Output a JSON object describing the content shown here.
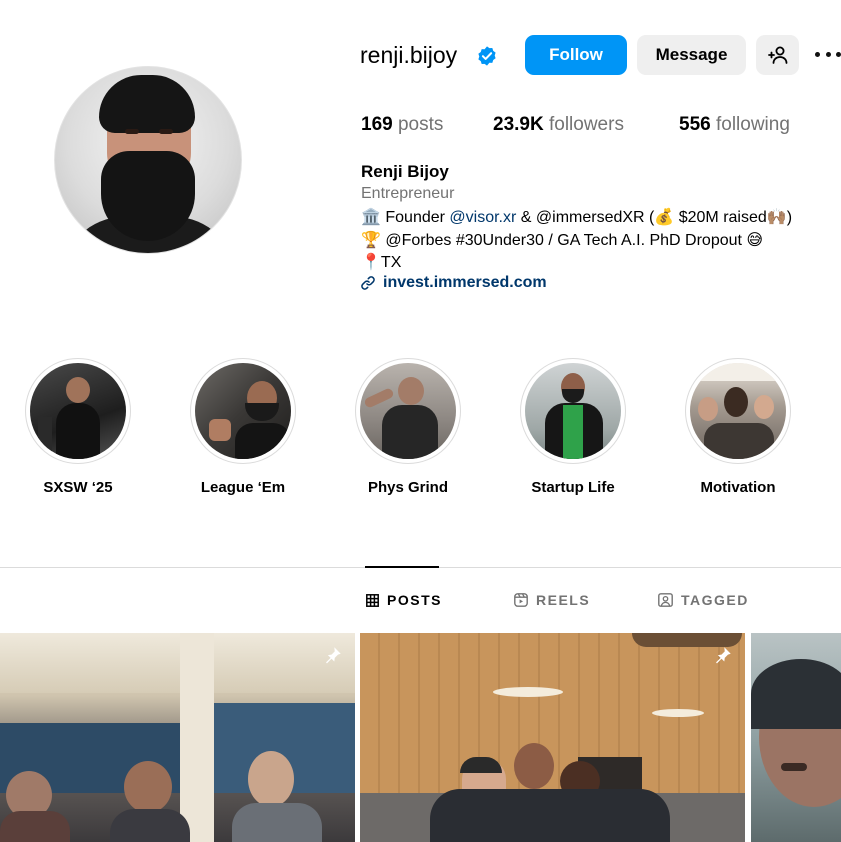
{
  "profile": {
    "username": "renji.bijoy",
    "verified_icon": "verified-badge-icon",
    "full_name": "Renji Bijoy",
    "category": "Entrepreneur",
    "stats": {
      "posts_count": "169",
      "posts_label": "posts",
      "followers_count": "23.9K",
      "followers_label": "followers",
      "following_count": "556",
      "following_label": "following"
    },
    "bio": {
      "line1_prefix": "🏛️ Founder ",
      "line1_link": "@visor.xr",
      "line1_suffix": " & @immersedXR (💰 $20M raised🙌🏽)",
      "line2": "🏆 @Forbes #30Under30 / GA Tech A.I. PhD Dropout 😅",
      "line3": "📍TX"
    },
    "link": "invest.immersed.com"
  },
  "actions": {
    "follow_label": "Follow",
    "message_label": "Message",
    "add_user_icon": "add-user-icon",
    "more_icon": "more-options-icon"
  },
  "highlights": [
    {
      "label": "SXSW ‘25"
    },
    {
      "label": "League ‘Em"
    },
    {
      "label": "Phys Grind"
    },
    {
      "label": "Startup Life"
    },
    {
      "label": "Motivation"
    }
  ],
  "tabs": [
    {
      "label": "POSTS",
      "icon": "grid-icon",
      "active": true
    },
    {
      "label": "REELS",
      "icon": "reels-icon",
      "active": false
    },
    {
      "label": "TAGGED",
      "icon": "tagged-icon",
      "active": false
    }
  ],
  "posts": [
    {
      "pinned": true,
      "icon": "pin-icon"
    },
    {
      "pinned": true,
      "icon": "pin-icon"
    },
    {
      "pinned": false
    }
  ],
  "colors": {
    "accent": "#0095f6",
    "link": "#00376b",
    "secondary_text": "#737373",
    "button_bg": "#efefef"
  }
}
